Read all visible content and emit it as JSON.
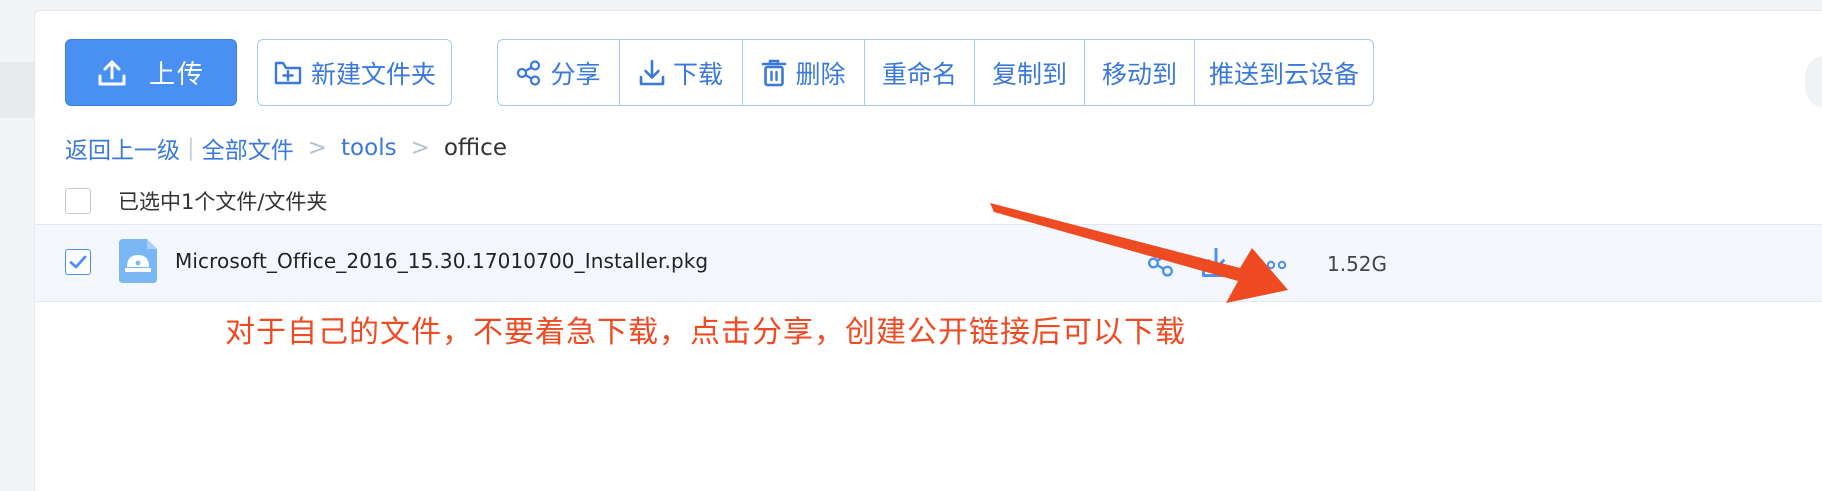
{
  "toolbar": {
    "upload_label": "上传",
    "new_folder_label": "新建文件夹",
    "share_label": "分享",
    "download_label": "下载",
    "delete_label": "删除",
    "rename_label": "重命名",
    "copy_to_label": "复制到",
    "move_to_label": "移动到",
    "push_label": "推送到云设备"
  },
  "breadcrumb": {
    "back": "返回上一级",
    "separator": "|",
    "root": "全部文件",
    "level1": "tools",
    "current": "office",
    "gt": ">"
  },
  "selection": {
    "text": "已选中1个文件/文件夹",
    "all_checked": false
  },
  "file": {
    "name": "Microsoft_Office_2016_15.30.17010700_Installer.pkg",
    "size": "1.52G",
    "checked": true,
    "icon": "package-file-icon"
  },
  "annotation": {
    "text": "对于自己的文件，不要着急下载，点击分享，创建公开链接后可以下载",
    "color": "#ef4b23"
  },
  "colors": {
    "accent": "#4a90f2",
    "link": "#3a79db",
    "arrow": "#ef4b23"
  }
}
